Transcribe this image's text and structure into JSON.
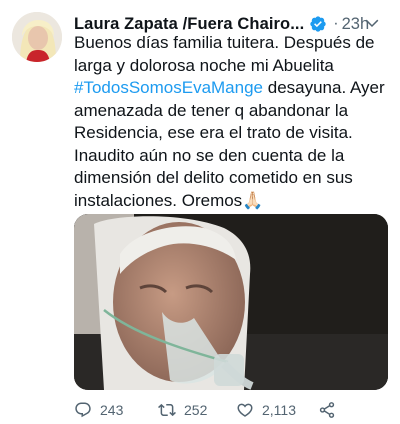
{
  "tweet": {
    "author_name": "Laura Zapata /Fuera Chairo...",
    "dot": "·",
    "time": "23h",
    "text_part1": "Buenos días familia tuitera. Después de larga y dolorosa noche mi Abuelita ",
    "hashtag": "#TodosSomosEvaMange",
    "text_part2": " desayuna. Ayer amenazada de tener q abandonar la Residencia, ese era el trato de visita. Inaudito aún no se den cuenta de la dimensión del delito cometido en sus instalaciones. Oremos",
    "emoji": "🙏🏻"
  },
  "actions": {
    "reply_count": "243",
    "retweet_count": "252",
    "like_count": "2,113"
  },
  "colors": {
    "link": "#1d9bf0",
    "verified": "#1d9bf0",
    "secondary_text": "#536471"
  },
  "icons": [
    "more-icon",
    "verified-badge-icon",
    "reply-icon",
    "retweet-icon",
    "like-icon",
    "share-icon"
  ]
}
